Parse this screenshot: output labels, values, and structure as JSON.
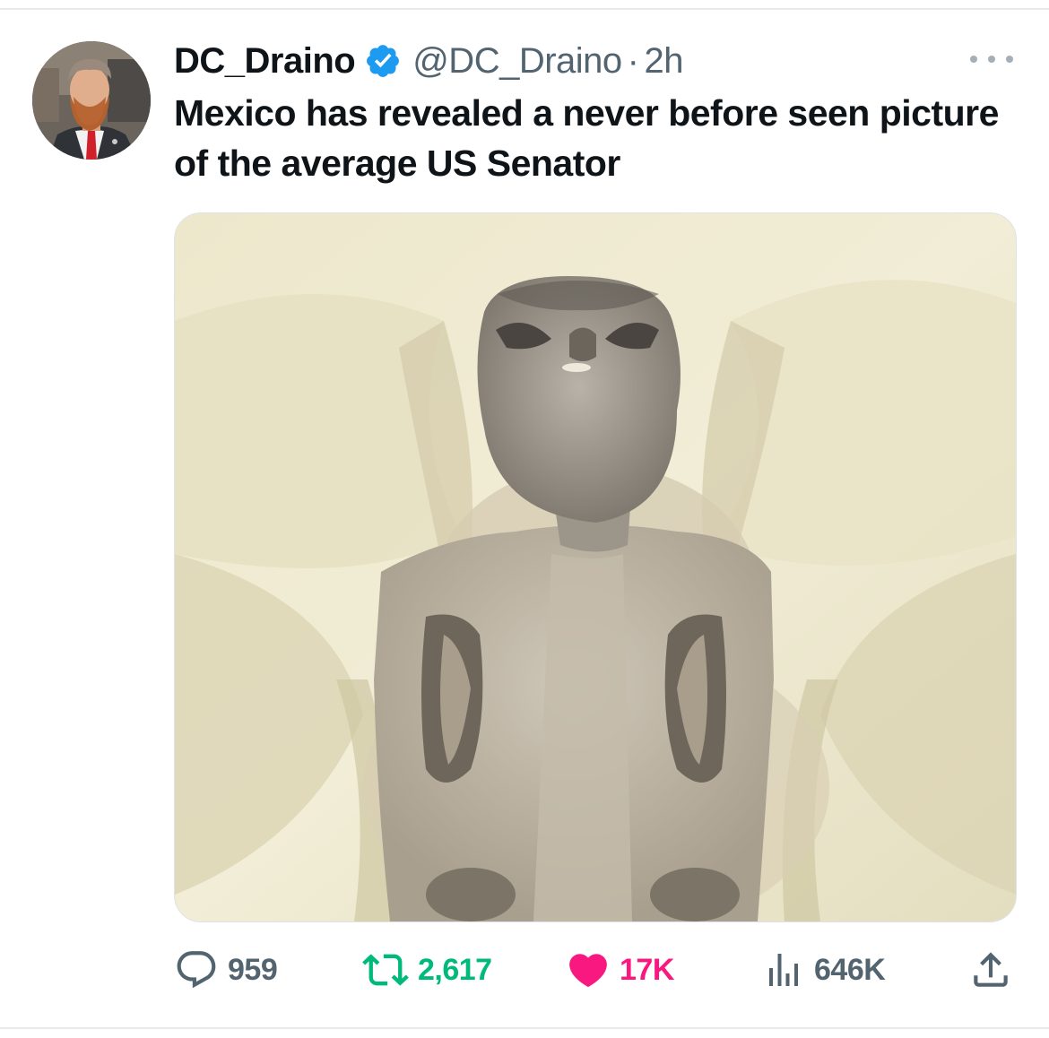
{
  "tweet": {
    "author": {
      "display_name": "DC_Draino",
      "handle": "@DC_Draino",
      "verified": true,
      "avatar_icon": "profile-photo"
    },
    "separator": "·",
    "time": "2h",
    "text": "Mexico has revealed a never before seen picture of the average US Senator",
    "more_icon": "ellipsis-icon",
    "media": {
      "type": "photo",
      "icon": "photo-image"
    },
    "actions": {
      "replies": "959",
      "retweets": "2,617",
      "likes": "17K",
      "views": "646K"
    },
    "colors": {
      "verified_badge": "#1d9bf0",
      "retweet_active": "#00ba7c",
      "like_active": "#f91880",
      "muted_text": "#536471",
      "primary_text": "#0f1419"
    }
  }
}
